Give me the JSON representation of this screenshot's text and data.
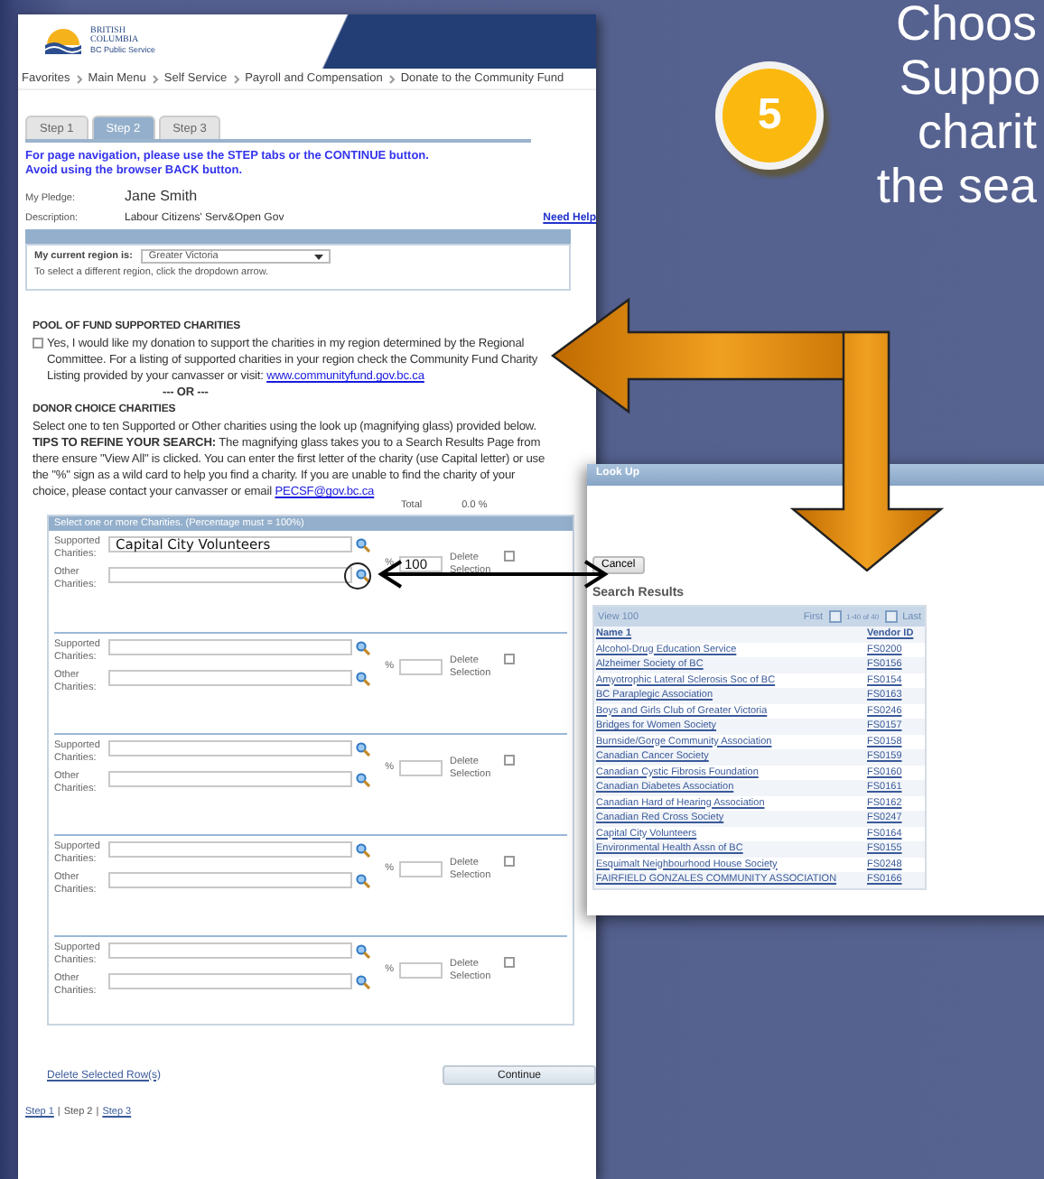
{
  "slide": {
    "step_number": "5",
    "caption_lines": [
      "Choos",
      "Suppo",
      "charit",
      "the sea"
    ]
  },
  "app": {
    "logo": {
      "line1": "BRITISH",
      "line2": "COLUMBIA",
      "line3": "BC Public Service"
    },
    "breadcrumbs": [
      "Favorites",
      "Main Menu",
      "Self Service",
      "Payroll and Compensation",
      "Donate to the Community Fund"
    ],
    "tabs": [
      {
        "label": "Step 1",
        "selected": false
      },
      {
        "label": "Step 2",
        "selected": true
      },
      {
        "label": "Step 3",
        "selected": false
      }
    ],
    "notice": [
      "For page navigation, please use the STEP tabs or the CONTINUE button.",
      "Avoid using the browser BACK button."
    ],
    "pledge": {
      "label": "My Pledge:",
      "value": "Jane Smith"
    },
    "description": {
      "label": "Description:",
      "value": "Labour Citizens' Serv&Open Gov"
    },
    "help_link": "Need Help",
    "region": {
      "label": "My current region is:",
      "value": "Greater Victoria",
      "hint": "To select a different region, click the dropdown arrow."
    },
    "pool": {
      "title": "POOL OF FUND SUPPORTED CHARITIES",
      "checked": false,
      "text": "Yes, I would like my donation to support the charities in my region determined by the Regional Committee. For a listing of supported charities in your region check the Community Fund Charity Listing provided by your canvasser or visit:",
      "link": "www.communityfund.gov.bc.ca"
    },
    "or_text": "--- OR ---",
    "donor": {
      "title": "DONOR CHOICE CHARITIES",
      "text": "Select one to ten Supported or Other charities using the look up (magnifying glass) provided below.",
      "tips": "**TIPS TO REFINE YOUR SEARCH:** The magnifying glass takes you to a Search Results Page from there ensure \"View All\" is clicked. You can enter the first letter of the charity (use Capital letter) or use the \"%\" sign as a wild card to help you find a charity. If you are unable to find the charity of your choice, please contact your canvasser or email",
      "email": "PECSF@gov.bc.ca"
    },
    "total": {
      "label": "Total",
      "value": "0.0",
      "unit": "%"
    },
    "section_header": "Select one or more Charities. (Percentage must = 100%)",
    "entries": [
      {
        "supported_label": "Supported Charities:",
        "supported_value": "Capital City Volunteers",
        "other_label": "Other Charities:",
        "percent_sign": "%",
        "percent": "100",
        "delete_label": "Delete Selection",
        "delete_checked": false
      },
      {
        "supported_label": "Supported Charities:",
        "other_label": "Other Charities:",
        "percent_sign": "%",
        "delete_label": "Delete Selection",
        "delete_checked": false
      },
      {
        "supported_label": "Supported Charities:",
        "other_label": "Other Charities:",
        "percent_sign": "%",
        "delete_label": "Delete Selection",
        "delete_checked": false
      },
      {
        "supported_label": "Supported Charities:",
        "other_label": "Other Charities:",
        "percent_sign": "%",
        "delete_label": "Delete Selection",
        "delete_checked": false
      },
      {
        "supported_label": "Supported Charities:",
        "other_label": "Other Charities:",
        "percent_sign": "%",
        "delete_label": "Delete Selection",
        "delete_checked": false
      }
    ],
    "delete_rows_link": "Delete Selected Row(s)",
    "continue_button": "Continue",
    "footer_separators": [
      "|",
      "|"
    ],
    "footer_steps": [
      {
        "label": "Step 1",
        "selected": false
      },
      {
        "label": "Step 2",
        "selected": true
      },
      {
        "label": "Step 3",
        "selected": false
      }
    ]
  },
  "lookup": {
    "title": "Look Up",
    "cancel_button": "Cancel",
    "heading": "Search Results",
    "view_link": "View 100",
    "first": "First",
    "range": "1-40 of 40",
    "last": "Last",
    "columns": [
      "Name 1",
      "Vendor ID"
    ],
    "rows": [
      [
        "Alcohol-Drug Education Service",
        "FS0200"
      ],
      [
        "Alzheimer Society of BC",
        "FS0156"
      ],
      [
        "Amyotrophic Lateral Sclerosis Soc of BC",
        "FS0154"
      ],
      [
        "BC Paraplegic Association",
        "FS0163"
      ],
      [
        "Boys and Girls Club of Greater Victoria",
        "FS0246"
      ],
      [
        "Bridges for Women Society",
        "FS0157"
      ],
      [
        "Burnside/Gorge Community Association",
        "FS0158"
      ],
      [
        "Canadian Cancer Society",
        "FS0159"
      ],
      [
        "Canadian Cystic Fibrosis Foundation",
        "FS0160"
      ],
      [
        "Canadian Diabetes Association",
        "FS0161"
      ],
      [
        "Canadian Hard of Hearing Association",
        "FS0162"
      ],
      [
        "Canadian Red Cross Society",
        "FS0247"
      ],
      [
        "Capital City Volunteers",
        "FS0164"
      ],
      [
        "Environmental Health Assn of BC",
        "FS0155"
      ],
      [
        "Esquimalt Neighbourhood House Society",
        "FS0248"
      ],
      [
        "FAIRFIELD GONZALES COMMUNITY ASSOCIATION",
        "FS0166"
      ]
    ]
  }
}
